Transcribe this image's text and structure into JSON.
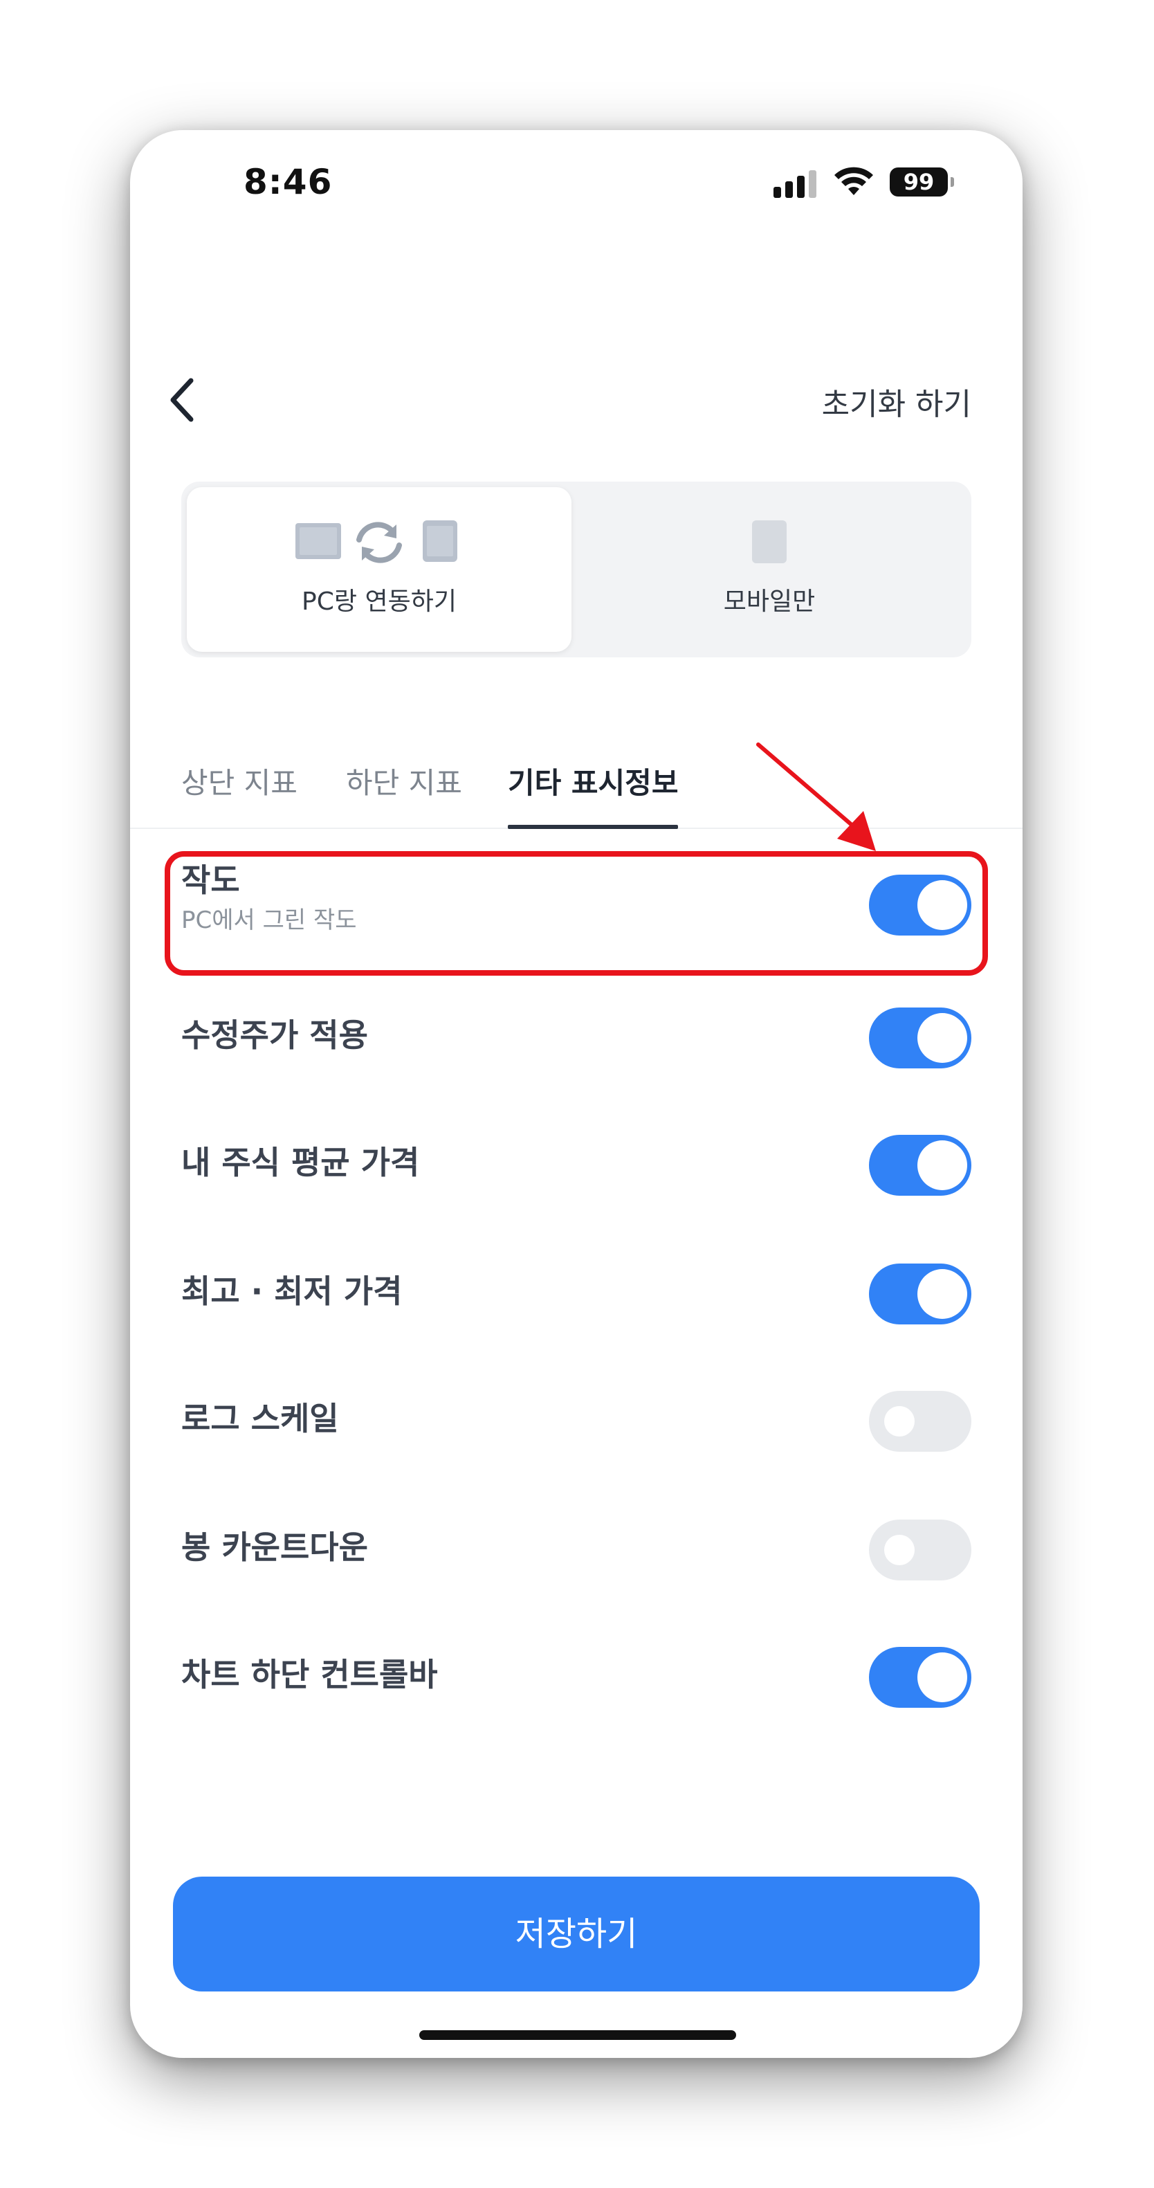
{
  "status_bar": {
    "time": "8:46",
    "battery": "99",
    "icons": [
      "signal-icon",
      "wifi-icon",
      "battery-icon"
    ]
  },
  "nav": {
    "back_icon": "chevron-left-icon",
    "reset_label": "초기화 하기"
  },
  "mode": {
    "options": [
      {
        "label": "PC랑 연동하기",
        "selected": true,
        "icons": [
          "monitor-icon",
          "sync-icon",
          "phone-icon"
        ]
      },
      {
        "label": "모바일만",
        "selected": false,
        "icons": [
          "phone-icon"
        ]
      }
    ]
  },
  "tabs": [
    {
      "label": "상단 지표",
      "active": false
    },
    {
      "label": "하단 지표",
      "active": false
    },
    {
      "label": "기타 표시정보",
      "active": true
    }
  ],
  "settings": [
    {
      "title": "작도",
      "subtitle": "PC에서 그린 작도",
      "on": true
    },
    {
      "title": "수정주가 적용",
      "on": true
    },
    {
      "title": "내 주식 평균 가격",
      "on": true
    },
    {
      "title": "최고 · 최저 가격",
      "on": true
    },
    {
      "title": "로그 스케일",
      "on": false
    },
    {
      "title": "봉 카운트다운",
      "on": false
    },
    {
      "title": "차트 하단 컨트롤바",
      "on": true
    }
  ],
  "save_button": "저장하기",
  "colors": {
    "accent": "#3182f6",
    "toggle_off": "#e8eaed",
    "highlight": "#e8141c",
    "text_primary": "#3c4350",
    "text_secondary": "#8c939c"
  }
}
